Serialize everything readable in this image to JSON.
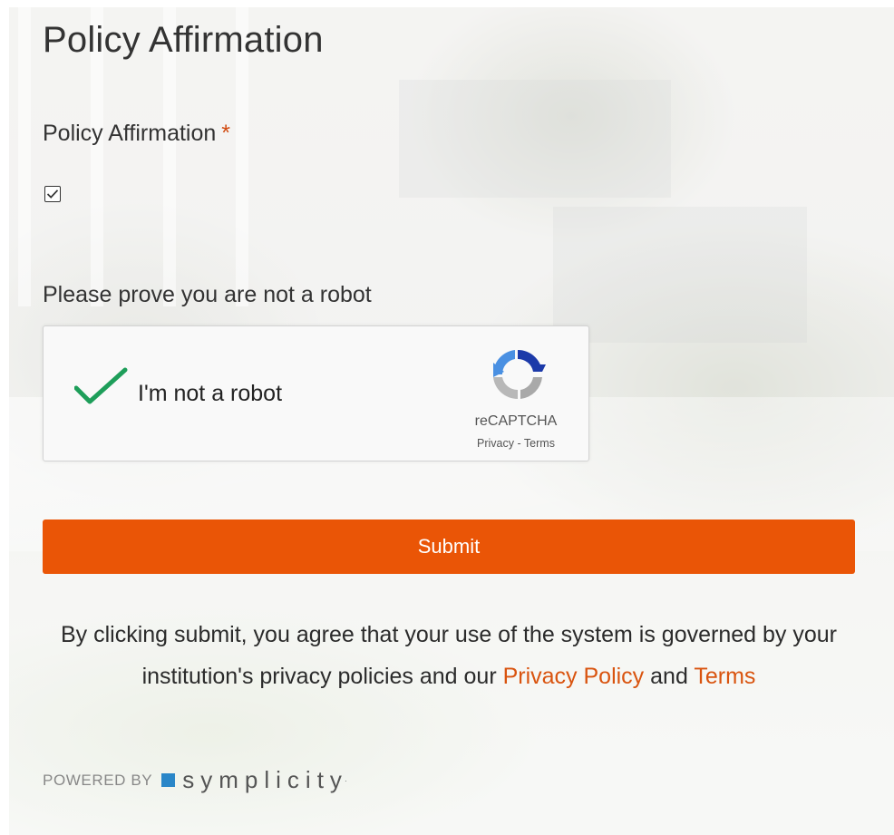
{
  "page": {
    "title": "Policy Affirmation"
  },
  "policy_field": {
    "label": "Policy Affirmation",
    "required_mark": "*",
    "checked": true
  },
  "robot_check": {
    "label": "Please prove you are not a robot",
    "widget_label": "I'm not a robot",
    "brand": "reCAPTCHA",
    "privacy_link": "Privacy",
    "separator": "-",
    "terms_link": "Terms",
    "verified": true
  },
  "submit": {
    "label": "Submit",
    "color": "#ea5506"
  },
  "agreement": {
    "text_before": "By clicking submit, you agree that your use of the system is governed by your institution's privacy policies and our",
    "privacy_link": "Privacy Policy",
    "text_mid": "and",
    "terms_link": "Terms"
  },
  "footer": {
    "powered_by": "POWERED BY",
    "brand": "symplicity",
    "trademark": "·",
    "brand_color": "#2a86c8"
  },
  "colors": {
    "accent": "#ea5506",
    "link": "#d9540f",
    "check_green": "#1e9e5a"
  }
}
